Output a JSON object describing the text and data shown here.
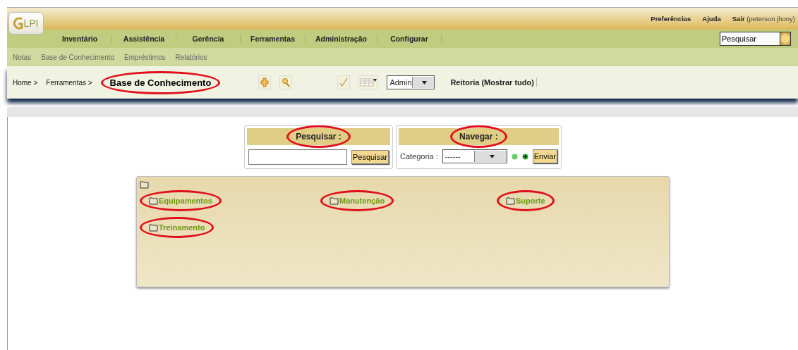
{
  "header": {
    "logo": "LPI",
    "user_links": [
      {
        "label": "Preferências"
      },
      {
        "label": "Ajuda"
      },
      {
        "label": "Sair",
        "detail": "(peterson jhony)"
      }
    ],
    "search": {
      "value": "Pesquisar"
    }
  },
  "menu": [
    {
      "label": "Inventário"
    },
    {
      "label": "Assistência"
    },
    {
      "label": "Gerência"
    },
    {
      "label": "Ferramentas"
    },
    {
      "label": "Administração"
    },
    {
      "label": "Configurar"
    }
  ],
  "submenu": [
    {
      "label": "Notas"
    },
    {
      "label": "Base de Conhecimento"
    },
    {
      "label": "Empréstimos"
    },
    {
      "label": "Relatórios"
    }
  ],
  "breadcrumb": [
    {
      "label": "Home >",
      "current": false,
      "circled": false
    },
    {
      "label": "Ferramentas >",
      "current": false,
      "circled": false
    },
    {
      "label": "Base de Conhecimento",
      "current": true,
      "circled": true
    }
  ],
  "entity_select": {
    "value": "Admin"
  },
  "entity_label": "Reitoria (Mostrar tudo)",
  "search_panel": {
    "title": "Pesquisar :",
    "circled": true,
    "button": "Pesquisar"
  },
  "browse_panel": {
    "title": "Navegar :",
    "circled": true,
    "label": "Categoria :",
    "select_value": "------",
    "button": "Enviar"
  },
  "categories": [
    {
      "label": "Equipamentos",
      "circled": true
    },
    {
      "label": "Manutenção",
      "circled": true
    },
    {
      "label": "Suporte",
      "circled": true
    },
    {
      "label": "Treinamento",
      "circled": true
    }
  ]
}
